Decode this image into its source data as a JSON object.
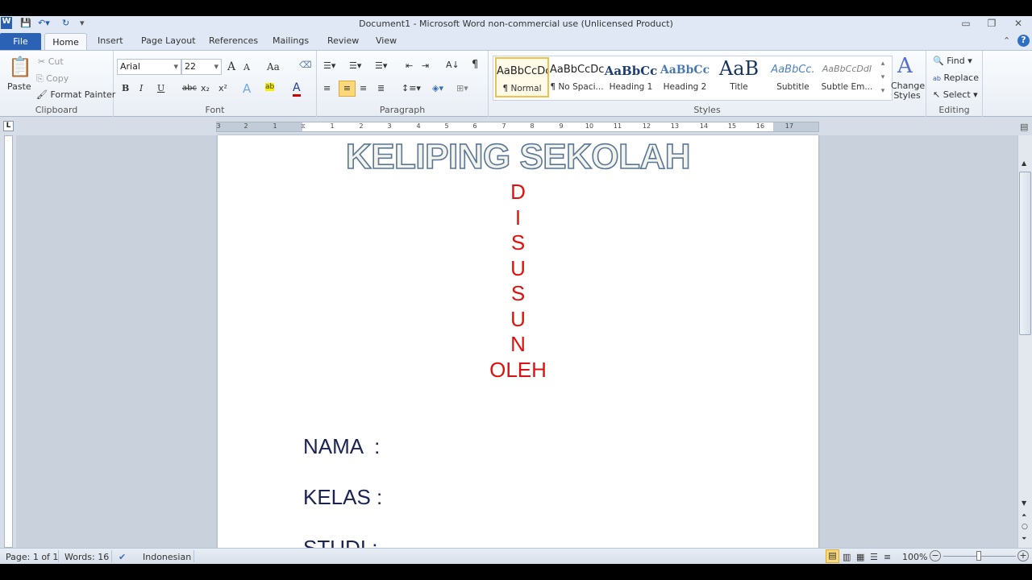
{
  "window": {
    "title": "Document1 - Microsoft Word non-commercial use (Unlicensed Product)",
    "app_icon": "W"
  },
  "tabs": [
    "File",
    "Home",
    "Insert",
    "Page Layout",
    "References",
    "Mailings",
    "Review",
    "View"
  ],
  "clipboard": {
    "paste": "Paste",
    "cut": "Cut",
    "copy": "Copy",
    "format_painter": "Format Painter",
    "label": "Clipboard"
  },
  "font": {
    "name": "Arial",
    "size": "22",
    "label": "Font",
    "grow": "A",
    "shrink": "A",
    "change_case": "Aa",
    "bold": "B",
    "italic": "I",
    "underline": "U",
    "strike": "abc",
    "subscript": "x₂",
    "superscript": "x²",
    "highlight": "ab",
    "color": "A"
  },
  "paragraph": {
    "label": "Paragraph",
    "pilcrow": "¶",
    "active_alignment": "center"
  },
  "styles": {
    "label": "Styles",
    "items": [
      {
        "preview": "AaBbCcDc",
        "name": "¶ Normal"
      },
      {
        "preview": "AaBbCcDc",
        "name": "¶ No Spaci..."
      },
      {
        "preview": "AaBbCc",
        "name": "Heading 1"
      },
      {
        "preview": "AaBbCc",
        "name": "Heading 2"
      },
      {
        "preview": "AaB",
        "name": "Title"
      },
      {
        "preview": "AaBbCc.",
        "name": "Subtitle"
      },
      {
        "preview": "AaBbCcDdI",
        "name": "Subtle Em..."
      }
    ],
    "change_styles": "Change Styles"
  },
  "editing": {
    "label": "Editing",
    "find": "Find",
    "replace": "Replace",
    "select": "Select"
  },
  "ruler": {
    "left": [
      "3",
      "2",
      "1"
    ],
    "right": [
      "1",
      "2",
      "3",
      "4",
      "5",
      "6",
      "7",
      "8",
      "9",
      "10",
      "11",
      "12",
      "13",
      "14",
      "15",
      "16",
      "17"
    ]
  },
  "document": {
    "heading": "KELIPING SEKOLAH",
    "vertical_letters": [
      "D",
      "I",
      "S",
      "U",
      "S",
      "U",
      "N",
      "OLEH"
    ],
    "fields": [
      "NAMA  :",
      "KELAS :",
      "STUDI :"
    ],
    "heading_outline_color": "#5a7696",
    "red_color": "#e01010",
    "field_color": "#1a2354"
  },
  "status": {
    "page": "Page: 1 of 1",
    "words": "Words: 16",
    "language": "Indonesian",
    "zoom": "100%",
    "zoom_percent": 100
  }
}
